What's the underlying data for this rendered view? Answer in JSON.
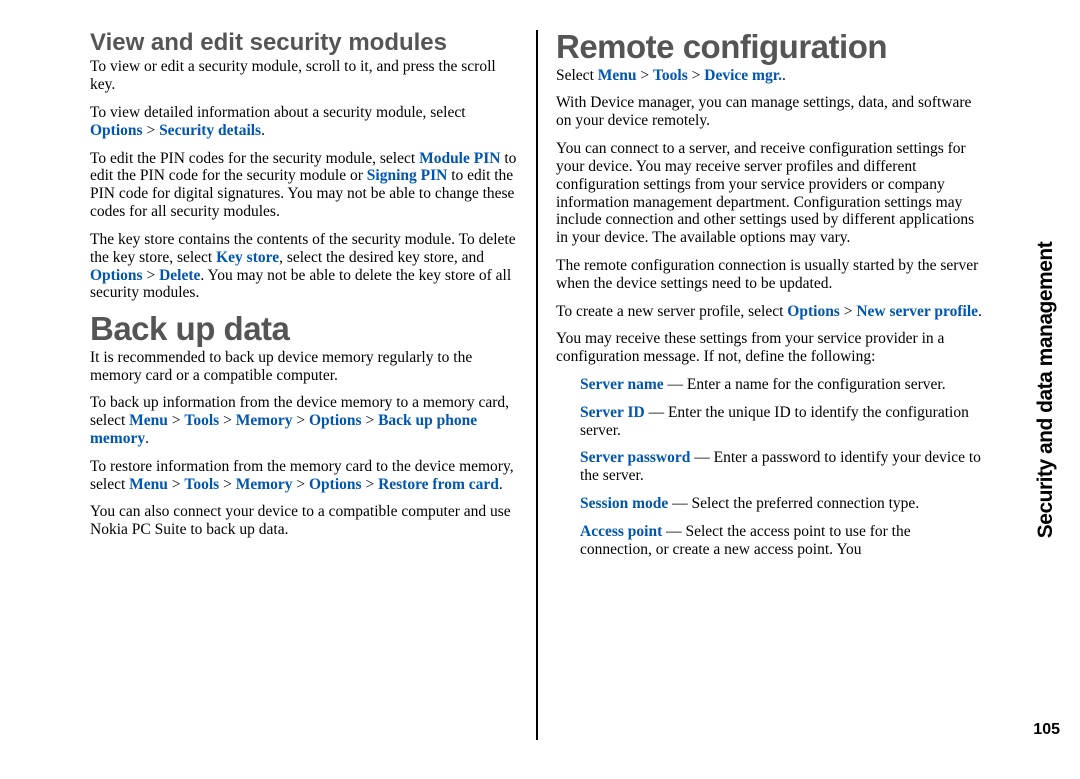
{
  "side_title": "Security and data management",
  "page_number": "105",
  "col1": {
    "h2_1": "View and edit security modules",
    "p1": "To view or edit a security module, scroll to it, and press the scroll key.",
    "p2_a": "To view detailed information about a security module, select ",
    "options": "Options",
    "gt": " > ",
    "sec_details": "Security details",
    "p3_a": "To edit the PIN codes for the security module, select ",
    "module_pin": "Module PIN",
    "p3_b": " to edit the PIN code for the security module or ",
    "signing_pin": "Signing PIN",
    "p3_c": " to edit the PIN code for digital signatures. You may not be able to change these codes for all security modules.",
    "p4_a": "The key store contains the contents of the security module. To delete the key store, select ",
    "key_store": "Key store",
    "p4_b": ", select the desired key store, and ",
    "delete": "Delete",
    "p4_c": ". You may not be able to delete the key store of all security modules.",
    "h1_1": "Back up data",
    "p5": "It is recommended to back up device memory regularly to the memory card or a compatible computer.",
    "p6_a": "To back up information from the device memory to a memory card, select ",
    "menu": "Menu",
    "tools": "Tools",
    "memory": "Memory",
    "backup": "Back up phone memory",
    "p7_a": "To restore information from the memory card to the device memory, select ",
    "restore": "Restore from card",
    "p8": "You can also connect your device to a compatible computer and use Nokia PC Suite to back up data."
  },
  "col2": {
    "h1_1": "Remote configuration",
    "sel": "Select ",
    "menu": "Menu",
    "gt": " > ",
    "tools": "Tools",
    "devmgr": "Device mgr.",
    "p1": "With Device manager, you can manage settings, data, and software on your device remotely.",
    "p2": "You can connect to a server, and receive configuration settings for your device. You may receive server profiles and different configuration settings from your service providers or company information management department. Configuration settings may include connection and other settings used by different applications in your device. The available options may vary.",
    "p3": "The remote configuration connection is usually started by the server when the device settings need to be updated.",
    "p4_a": "To create a new server profile, select ",
    "options": "Options",
    "new_server": "New server profile",
    "p5": "You may receive these settings from your service provider in a configuration message. If not, define the following:",
    "sn": "Server name",
    "sn_t": " — Enter a name for the configuration server.",
    "sid": "Server ID",
    "sid_t": " — Enter the unique ID to identify the configuration server.",
    "spw": "Server password",
    "spw_t": " — Enter a password to identify your device to the server.",
    "sm": "Session mode",
    "sm_t": " — Select the preferred connection type.",
    "ap": "Access point",
    "ap_t": " — Select the access point to use for the connection, or create a new access point. You"
  }
}
